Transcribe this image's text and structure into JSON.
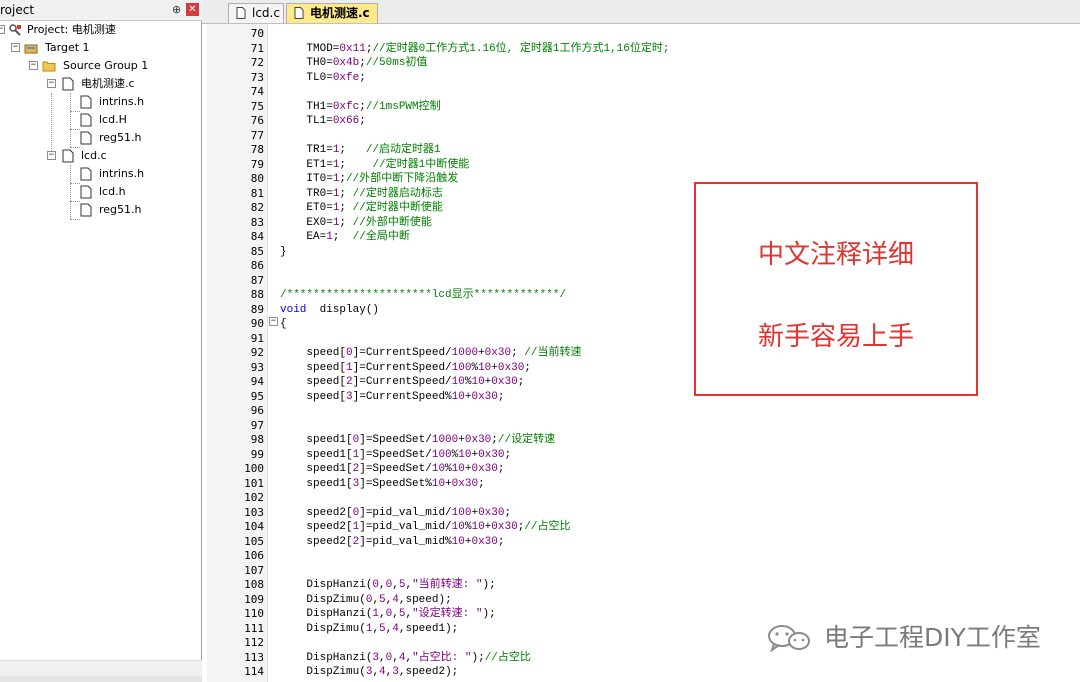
{
  "project_panel": {
    "title": "roject",
    "pin_icon": "pin-icon",
    "close_icon": "close-icon",
    "tree": [
      {
        "label": "Project: 电机测速",
        "icon": "project-icon"
      },
      {
        "label": "Target 1",
        "icon": "target-icon"
      },
      {
        "label": "Source Group 1",
        "icon": "folder-icon"
      },
      {
        "label": "电机测速.c",
        "icon": "file-icon"
      },
      {
        "label": "intrins.h",
        "icon": "file-icon"
      },
      {
        "label": "lcd.H",
        "icon": "file-icon"
      },
      {
        "label": "reg51.h",
        "icon": "file-icon"
      },
      {
        "label": "lcd.c",
        "icon": "file-icon"
      },
      {
        "label": "intrins.h",
        "icon": "file-icon"
      },
      {
        "label": "lcd.h",
        "icon": "file-icon"
      },
      {
        "label": "reg51.h",
        "icon": "file-icon"
      }
    ]
  },
  "tabs": [
    {
      "label": "lcd.c",
      "active": false
    },
    {
      "label": "电机测速.c",
      "active": true
    }
  ],
  "editor": {
    "lines": [
      {
        "n": "70",
        "code": ""
      },
      {
        "n": "71",
        "code": "    TMOD=0x11;//定时器0工作方式1.16位, 定时器1工作方式1,16位定时;"
      },
      {
        "n": "72",
        "code": "    TH0=0x4b;//50ms初值"
      },
      {
        "n": "73",
        "code": "    TL0=0xfe;"
      },
      {
        "n": "74",
        "code": ""
      },
      {
        "n": "75",
        "code": "    TH1=0xfc;//1msPWM控制"
      },
      {
        "n": "76",
        "code": "    TL1=0x66;"
      },
      {
        "n": "77",
        "code": ""
      },
      {
        "n": "78",
        "code": "    TR1=1;   //启动定时器1"
      },
      {
        "n": "79",
        "code": "    ET1=1;    //定时器1中断使能"
      },
      {
        "n": "80",
        "code": "    IT0=1;//外部中断下降沿触发"
      },
      {
        "n": "81",
        "code": "    TR0=1; //定时器启动标志"
      },
      {
        "n": "82",
        "code": "    ET0=1; //定时器中断使能"
      },
      {
        "n": "83",
        "code": "    EX0=1; //外部中断使能"
      },
      {
        "n": "84",
        "code": "    EA=1;  //全局中断"
      },
      {
        "n": "85",
        "code": "}"
      },
      {
        "n": "86",
        "code": ""
      },
      {
        "n": "87",
        "code": ""
      },
      {
        "n": "88",
        "code": "/**********************lcd显示*************/"
      },
      {
        "n": "89",
        "code": "void  display()"
      },
      {
        "n": "90",
        "code": "{"
      },
      {
        "n": "91",
        "code": ""
      },
      {
        "n": "92",
        "code": "    speed[0]=CurrentSpeed/1000+0x30; //当前转速"
      },
      {
        "n": "93",
        "code": "    speed[1]=CurrentSpeed/100%10+0x30;"
      },
      {
        "n": "94",
        "code": "    speed[2]=CurrentSpeed/10%10+0x30;"
      },
      {
        "n": "95",
        "code": "    speed[3]=CurrentSpeed%10+0x30;"
      },
      {
        "n": "96",
        "code": ""
      },
      {
        "n": "97",
        "code": ""
      },
      {
        "n": "98",
        "code": "    speed1[0]=SpeedSet/1000+0x30;//设定转速"
      },
      {
        "n": "99",
        "code": "    speed1[1]=SpeedSet/100%10+0x30;"
      },
      {
        "n": "100",
        "code": "    speed1[2]=SpeedSet/10%10+0x30;"
      },
      {
        "n": "101",
        "code": "    speed1[3]=SpeedSet%10+0x30;"
      },
      {
        "n": "102",
        "code": ""
      },
      {
        "n": "103",
        "code": "    speed2[0]=pid_val_mid/100+0x30;"
      },
      {
        "n": "104",
        "code": "    speed2[1]=pid_val_mid/10%10+0x30;//占空比"
      },
      {
        "n": "105",
        "code": "    speed2[2]=pid_val_mid%10+0x30;"
      },
      {
        "n": "106",
        "code": ""
      },
      {
        "n": "107",
        "code": ""
      },
      {
        "n": "108",
        "code": "    DispHanzi(0,0,5,\"当前转速: \");"
      },
      {
        "n": "109",
        "code": "    DispZimu(0,5,4,speed);"
      },
      {
        "n": "110",
        "code": "    DispHanzi(1,0,5,\"设定转速: \");"
      },
      {
        "n": "111",
        "code": "    DispZimu(1,5,4,speed1);"
      },
      {
        "n": "112",
        "code": ""
      },
      {
        "n": "113",
        "code": "    DispHanzi(3,0,4,\"占空比: \");//占空比"
      },
      {
        "n": "114",
        "code": "    DispZimu(3,4,3,speed2);"
      }
    ]
  },
  "callout": {
    "line1": "中文注释详细",
    "line2": "新手容易上手",
    "color": "#e3332e"
  },
  "watermark": {
    "text": "电子工程DIY工作室",
    "icon": "wechat-icon"
  }
}
